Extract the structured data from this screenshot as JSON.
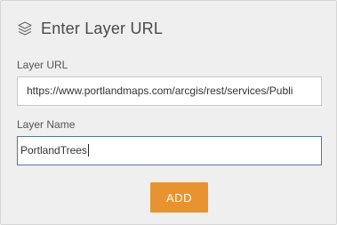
{
  "header": {
    "icon": "layers-icon",
    "title": "Enter Layer URL"
  },
  "form": {
    "url_label": "Layer URL",
    "url_value": "https://www.portlandmaps.com/arcgis/rest/services/Publi",
    "name_label": "Layer Name",
    "name_value": "PortlandTrees"
  },
  "actions": {
    "add_label": "ADD"
  },
  "colors": {
    "accent": "#e8932f",
    "focused_border": "#55779a",
    "panel_background": "#efefef"
  }
}
